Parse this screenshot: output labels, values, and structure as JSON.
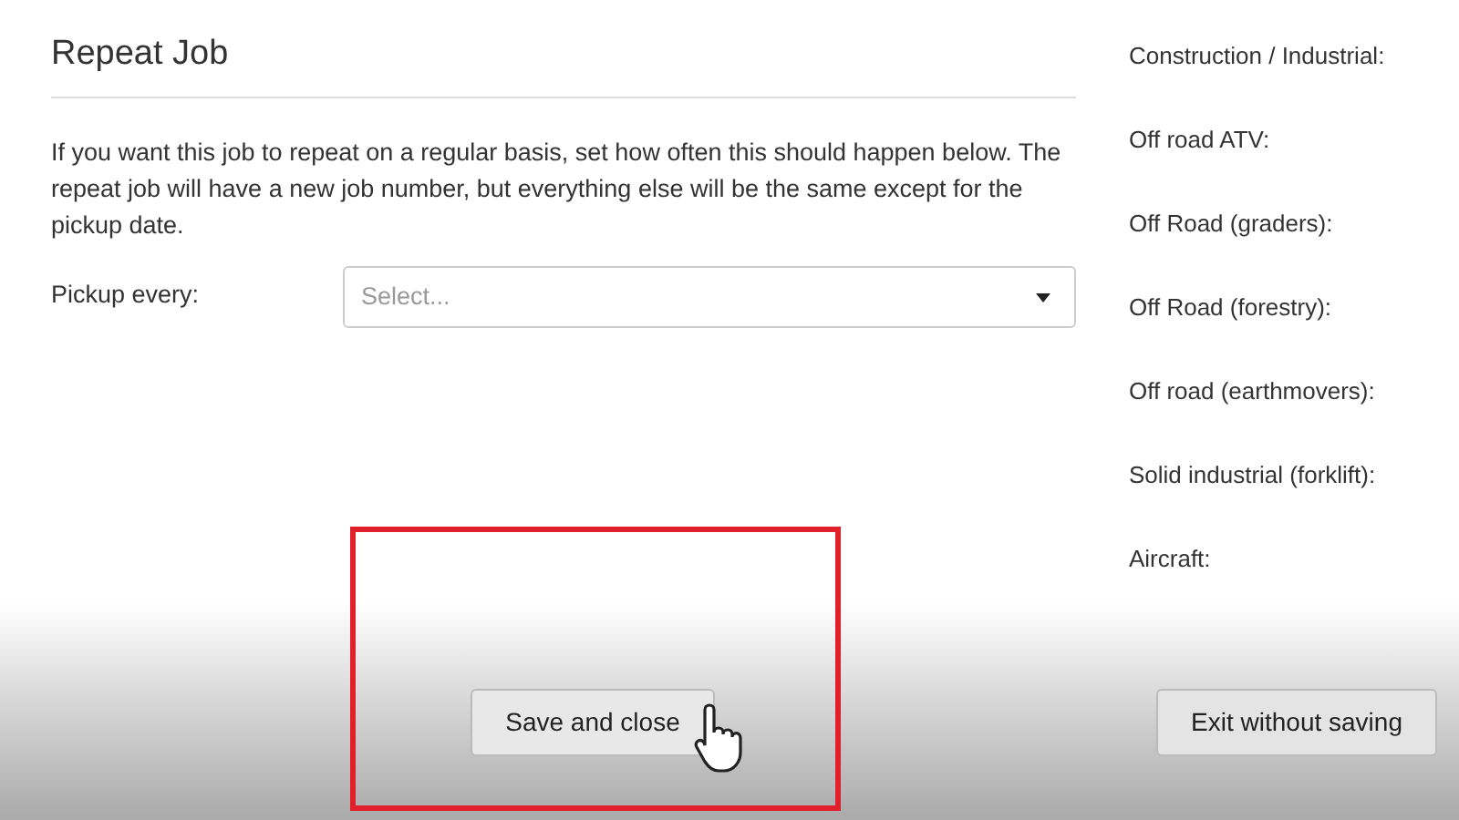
{
  "section": {
    "title": "Repeat Job",
    "description": "If you want this job to repeat on a regular basis, set how often this should happen below. The repeat job will have a new job number, but everything else will be the same except for the pickup date."
  },
  "pickup": {
    "label": "Pickup every:",
    "placeholder": "Select..."
  },
  "categories": [
    "Construction / Industrial:",
    "Off road ATV:",
    "Off Road (graders):",
    "Off Road (forestry):",
    "Off road (earthmovers):",
    "Solid industrial (forklift):",
    "Aircraft:"
  ],
  "buttons": [
    "Save and close",
    "Exit without saving"
  ]
}
